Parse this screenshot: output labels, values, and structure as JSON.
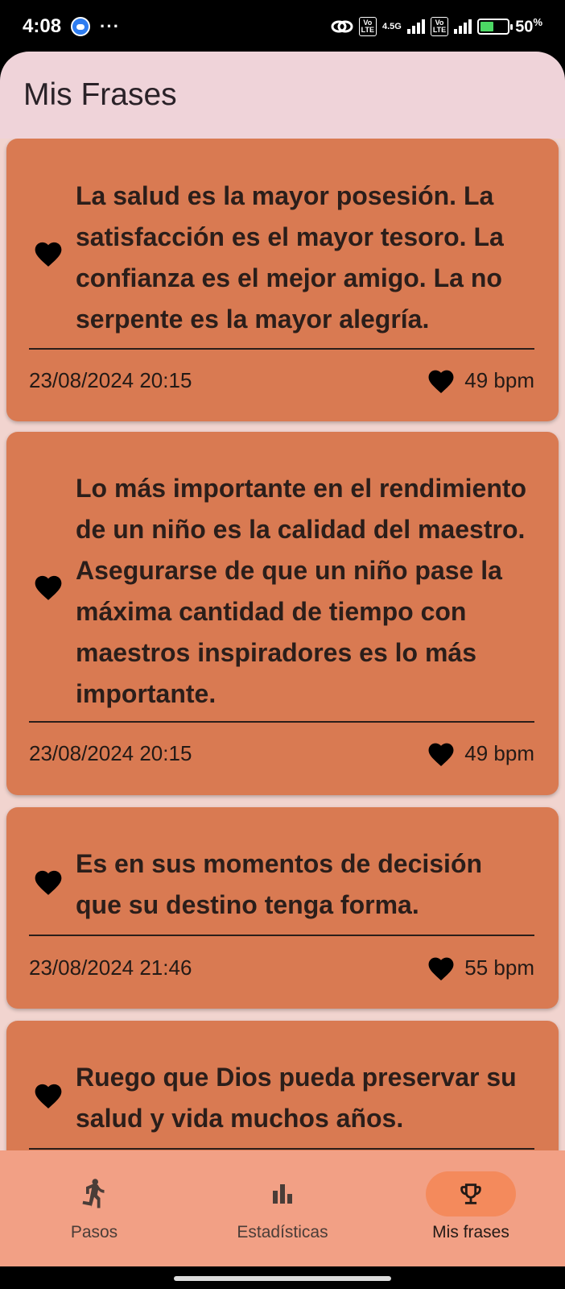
{
  "status_bar": {
    "time": "4:08",
    "dots": "···",
    "network": "4.5G",
    "volte": "Vo LTE",
    "battery": "50",
    "battery_unit": "%"
  },
  "app_bar": {
    "title": "Mis Frases"
  },
  "cards": [
    {
      "quote": "La salud es la mayor posesión. La satisfacción es el mayor tesoro. La confianza es el mejor amigo. La no serpente es la mayor alegría.",
      "date": "23/08/2024 20:15",
      "bpm": "49 bpm"
    },
    {
      "quote": "Lo más importante en el rendimiento de un niño es la calidad del maestro. Asegurarse de que un niño pase la máxima cantidad de tiempo con maestros inspiradores es lo más importante.",
      "date": "23/08/2024 20:15",
      "bpm": "49 bpm"
    },
    {
      "quote": "Es en sus momentos de decisión que su destino tenga forma.",
      "date": "23/08/2024 21:46",
      "bpm": "55 bpm"
    },
    {
      "quote": "Ruego que Dios pueda preservar su salud y vida muchos años.",
      "date": "",
      "bpm": ""
    }
  ],
  "bottom_nav": {
    "items": [
      {
        "label": "Pasos",
        "icon": "walk-icon",
        "active": false
      },
      {
        "label": "Estadísticas",
        "icon": "bar-chart-icon",
        "active": false
      },
      {
        "label": "Mis frases",
        "icon": "trophy-icon",
        "active": true
      }
    ]
  },
  "colors": {
    "card": "#d97a52",
    "background": "#f1d4cf",
    "nav": "#f2a085",
    "nav_active_pill": "#f48a5c"
  }
}
